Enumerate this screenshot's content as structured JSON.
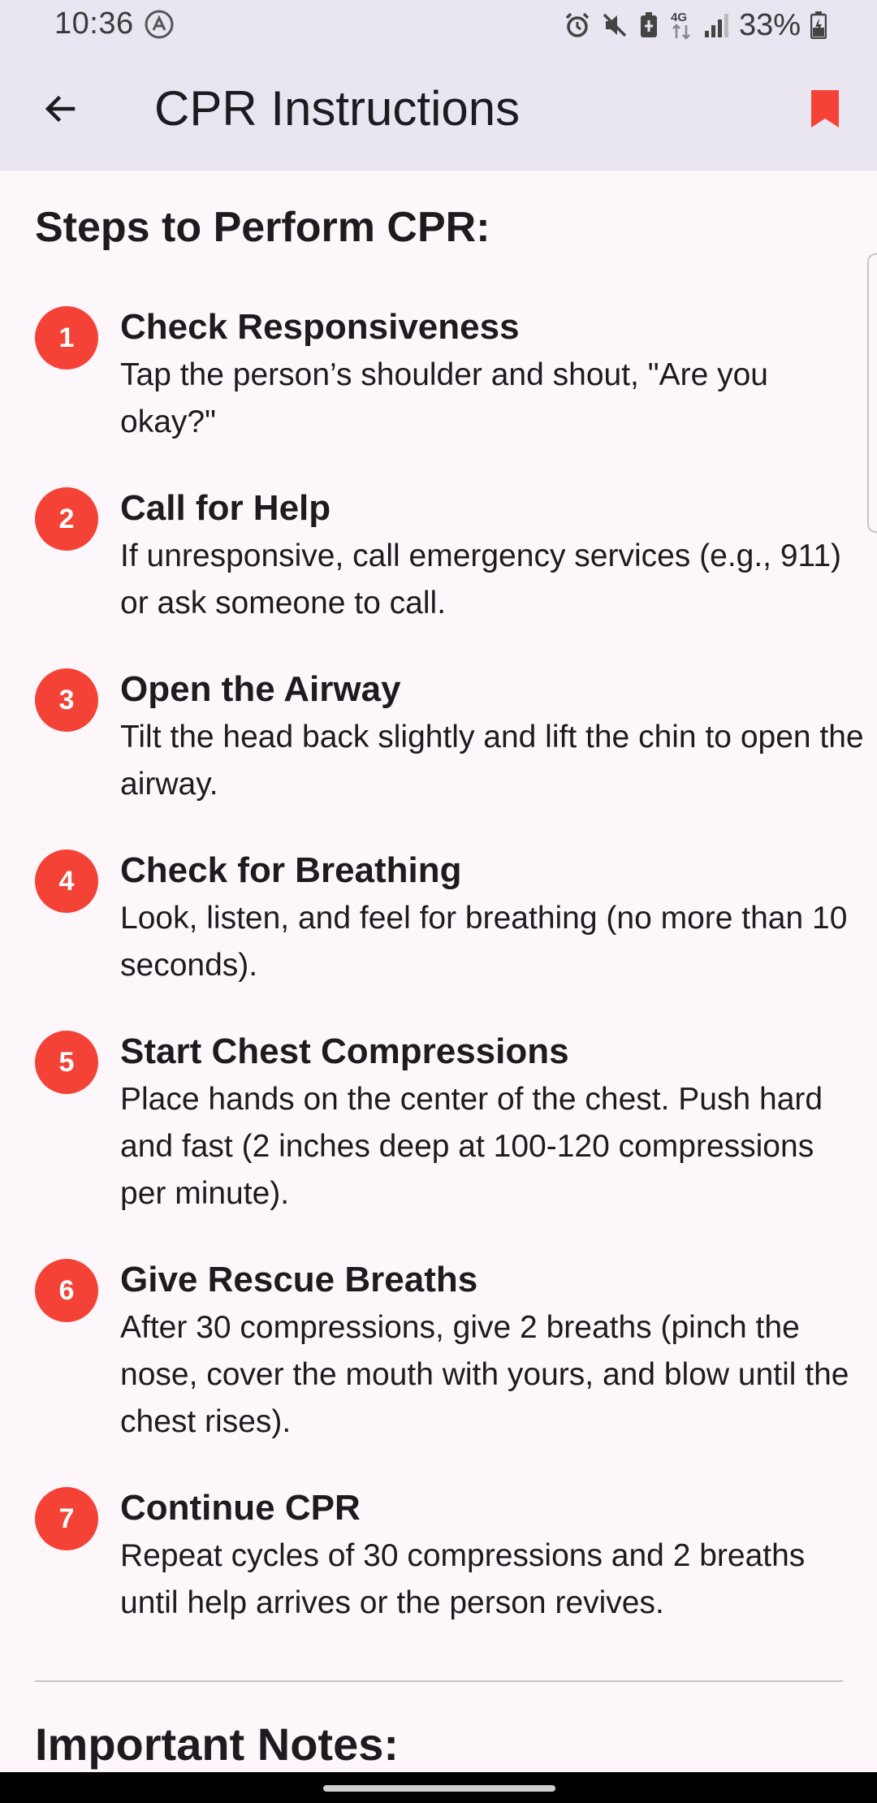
{
  "status_bar": {
    "time": "10:36",
    "battery": "33%",
    "network": "4G",
    "icons": [
      "accessibility-icon",
      "alarm-icon",
      "mute-icon",
      "battery-saver-icon",
      "data-arrows-icon",
      "signal-icon",
      "battery-icon"
    ]
  },
  "app_bar": {
    "title": "CPR Instructions",
    "back_icon": "arrow-back-icon",
    "bookmark_icon": "bookmark-icon"
  },
  "colors": {
    "accent": "#f44336",
    "app_bar_bg": "#e9e5f1",
    "page_bg": "#fdf7fc",
    "text": "#1d1b20"
  },
  "content": {
    "steps_heading": "Steps to Perform CPR:",
    "steps": [
      {
        "number": "1",
        "title": "Check Responsiveness",
        "description": "Tap the person’s shoulder and shout, \"Are you okay?\""
      },
      {
        "number": "2",
        "title": "Call for Help",
        "description": "If unresponsive, call emergency services (e.g., 911) or ask someone to call."
      },
      {
        "number": "3",
        "title": "Open the Airway",
        "description": "Tilt the head back slightly and lift the chin to open the airway."
      },
      {
        "number": "4",
        "title": "Check for Breathing",
        "description": "Look, listen, and feel for breathing (no more than 10 seconds)."
      },
      {
        "number": "5",
        "title": "Start Chest Compressions",
        "description": "Place hands on the center of the chest. Push hard and fast (2 inches deep at 100-120 compressions per minute)."
      },
      {
        "number": "6",
        "title": "Give Rescue Breaths",
        "description": "After 30 compressions, give 2 breaths (pinch the nose, cover the mouth with yours, and blow until the chest rises)."
      },
      {
        "number": "7",
        "title": "Continue CPR",
        "description": "Repeat cycles of 30 compressions and 2 breaths until help arrives or the person revives."
      }
    ],
    "notes_heading": "Important Notes:"
  }
}
